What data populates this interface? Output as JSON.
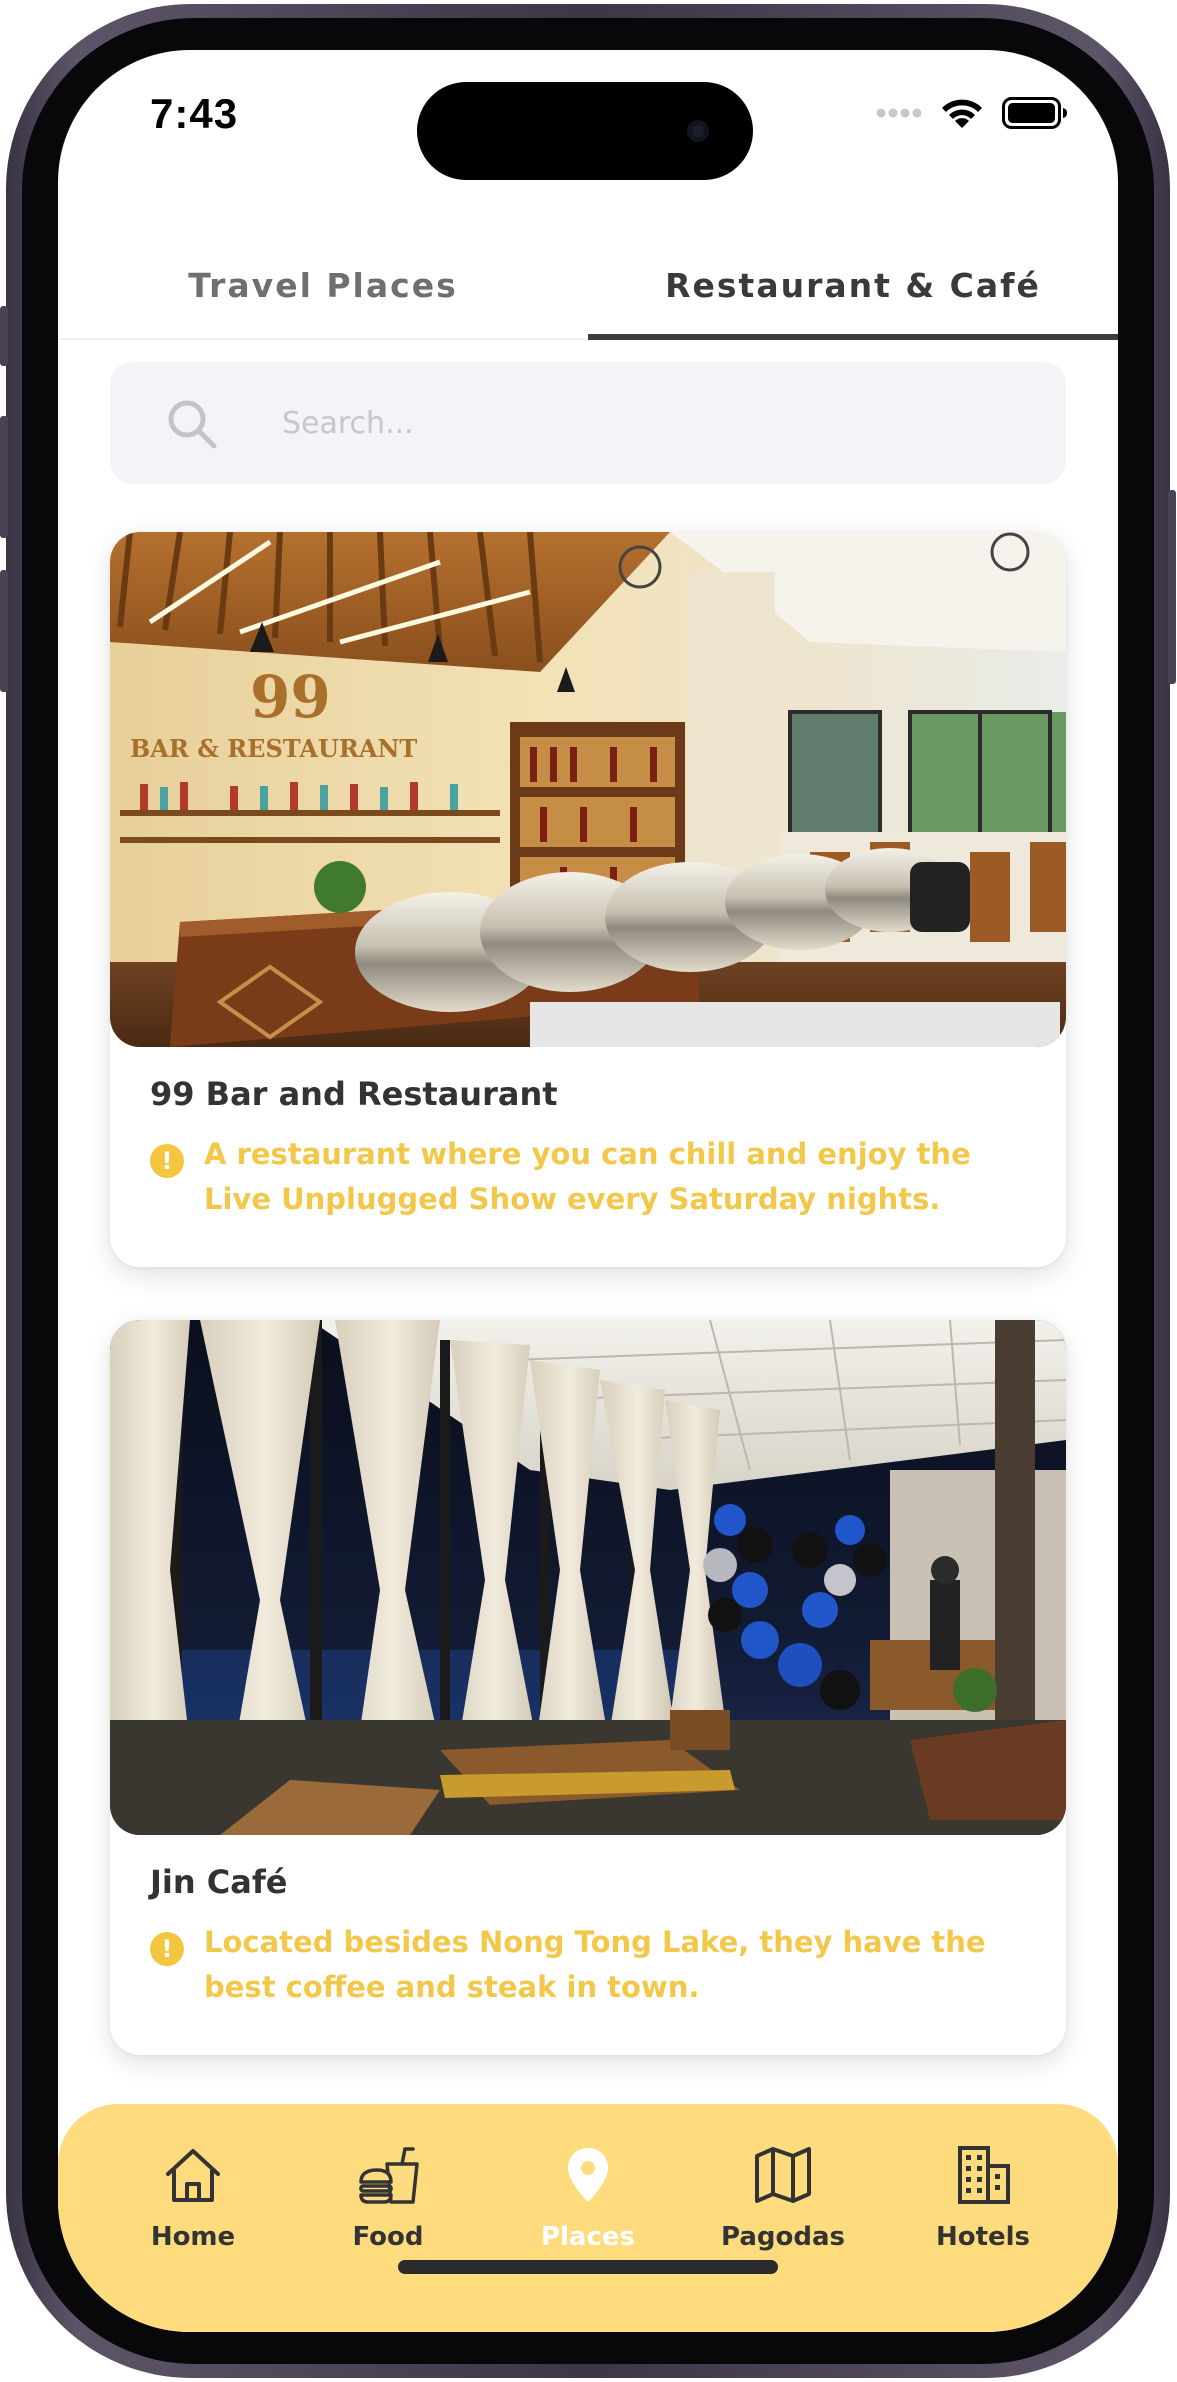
{
  "status_bar": {
    "time": "7:43"
  },
  "tabs": [
    {
      "label": "Travel Places",
      "active": false
    },
    {
      "label": "Restaurant & Café",
      "active": true
    }
  ],
  "search": {
    "placeholder": "Search...",
    "value": ""
  },
  "cards": [
    {
      "title": "99 Bar and Restaurant",
      "description": "A restaurant where you can chill and enjoy the Live Unplugged Show every Saturday nights.",
      "image_sign_number": "99",
      "image_sign_text": "BAR & RESTAURANT"
    },
    {
      "title": "Jin Café",
      "description": "Located besides Nong Tong Lake, they have the best coffee and steak in town."
    }
  ],
  "bottom_nav": [
    {
      "label": "Home",
      "icon": "home-icon",
      "active": false
    },
    {
      "label": "Food",
      "icon": "food-icon",
      "active": false
    },
    {
      "label": "Places",
      "icon": "map-pin-icon",
      "active": true
    },
    {
      "label": "Pagodas",
      "icon": "map-icon",
      "active": false
    },
    {
      "label": "Hotels",
      "icon": "building-icon",
      "active": false
    }
  ],
  "colors": {
    "accent_yellow": "#fedc7e",
    "description_text": "#f3c84a",
    "info_icon": "#f4c63f",
    "active_tab_underline": "#3c3c3c",
    "search_bg": "#f3f4f7"
  }
}
